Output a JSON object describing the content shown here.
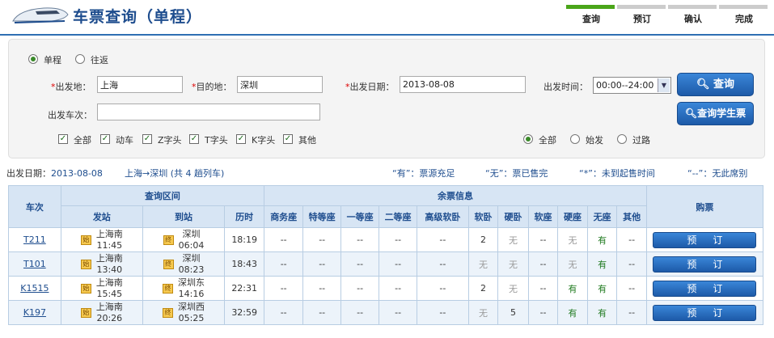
{
  "header": {
    "title": "车票查询（单程）",
    "steps": [
      "查询",
      "预订",
      "确认",
      "完成"
    ],
    "active_step": 0
  },
  "search": {
    "trip_types": [
      "单程",
      "往返"
    ],
    "selected_trip": "单程",
    "from_label": "出发地：",
    "from_value": "上海",
    "to_label": "目的地：",
    "to_value": "深圳",
    "date_label": "出发日期：",
    "date_value": "2013-08-08",
    "time_label": "出发时间：",
    "time_value": "00:00--24:00",
    "train_label": "出发车次：",
    "train_value": "",
    "train_types": [
      "全部",
      "动车",
      "Z字头",
      "T字头",
      "K字头",
      "其他"
    ],
    "station_types": [
      "全部",
      "始发",
      "过路"
    ],
    "search_button": "查询",
    "student_button": "查询学生票"
  },
  "info": {
    "date_label": "出发日期：",
    "date": "2013-08-08",
    "route": "上海→深圳",
    "count_prefix": "(共",
    "count": "4",
    "count_suffix": "趟列车)",
    "legend": [
      "“有”：票源充足",
      "“无”：票已售完",
      "“*”：未到起售时间",
      "“--”：无此席别"
    ]
  },
  "table": {
    "col_train": "车次",
    "group_interval": "查询区间",
    "group_seats": "余票信息",
    "col_buy": "购票",
    "col_depart": "发站",
    "col_arrive": "到站",
    "col_duration": "历时",
    "seat_types": [
      "商务座",
      "特等座",
      "一等座",
      "二等座",
      "高级软卧",
      "软卧",
      "硬卧",
      "软座",
      "硬座",
      "无座",
      "其他"
    ],
    "start_tag": "始",
    "end_tag": "终",
    "book_label": "预订",
    "rows": [
      {
        "train": "T211",
        "from": "上海南",
        "dep": "11:45",
        "to": "深圳",
        "arr": "06:04",
        "duration": "18:19",
        "seats": [
          "--",
          "--",
          "--",
          "--",
          "--",
          "2",
          "无",
          "--",
          "无",
          "有",
          "--"
        ]
      },
      {
        "train": "T101",
        "from": "上海南",
        "dep": "13:40",
        "to": "深圳",
        "arr": "08:23",
        "duration": "18:43",
        "seats": [
          "--",
          "--",
          "--",
          "--",
          "--",
          "无",
          "无",
          "--",
          "无",
          "有",
          "--"
        ]
      },
      {
        "train": "K1515",
        "from": "上海南",
        "dep": "15:45",
        "to": "深圳东",
        "arr": "14:16",
        "duration": "22:31",
        "seats": [
          "--",
          "--",
          "--",
          "--",
          "--",
          "2",
          "无",
          "--",
          "有",
          "有",
          "--"
        ]
      },
      {
        "train": "K197",
        "from": "上海南",
        "dep": "20:26",
        "to": "深圳西",
        "arr": "05:25",
        "duration": "32:59",
        "seats": [
          "--",
          "--",
          "--",
          "--",
          "--",
          "无",
          "5",
          "--",
          "有",
          "有",
          "--"
        ]
      }
    ]
  }
}
